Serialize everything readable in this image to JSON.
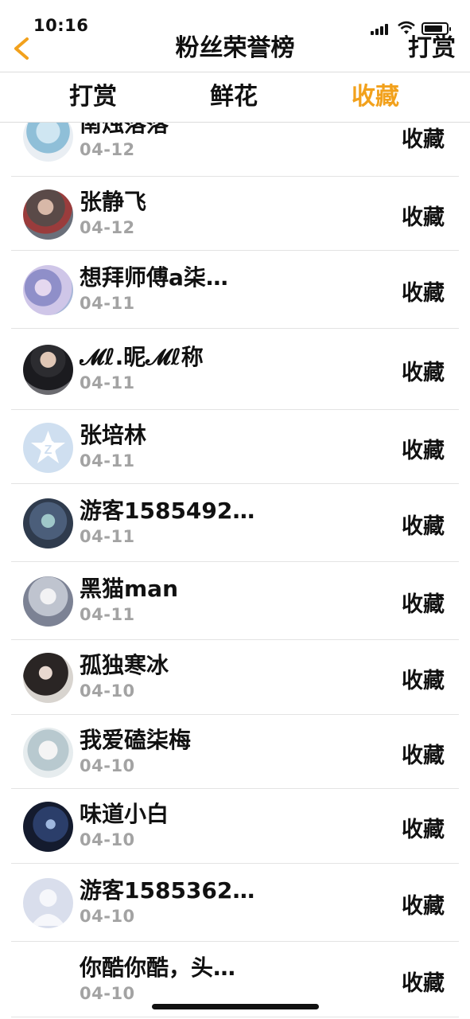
{
  "status_bar": {
    "time": "10:16",
    "battery_level": 0.85
  },
  "nav": {
    "title": "粉丝荣誉榜",
    "right_label": "打赏",
    "back_icon": "chevron-left-icon",
    "accent_color": "#f2a11c"
  },
  "tabs": [
    {
      "label": "打赏",
      "active": false
    },
    {
      "label": "鲜花",
      "active": false
    },
    {
      "label": "收藏",
      "active": true
    }
  ],
  "list": {
    "items": [
      {
        "name": "南烛落落",
        "date": "04-12",
        "action": "收藏",
        "avatar": "anime-girl-blue-hair"
      },
      {
        "name": "张静飞",
        "date": "04-12",
        "action": "收藏",
        "avatar": "anime-boy-dark"
      },
      {
        "name": "想拜师傅a柒…",
        "date": "04-11",
        "action": "收藏",
        "avatar": "anime-couple-pastel"
      },
      {
        "name": "𝓜ℓ.昵𝓜ℓ称",
        "date": "04-11",
        "action": "收藏",
        "avatar": "boy-photo-dark-shirt"
      },
      {
        "name": "张培林",
        "date": "04-11",
        "action": "收藏",
        "avatar": "default-star-icon"
      },
      {
        "name": "游客1585492…",
        "date": "04-11",
        "action": "收藏",
        "avatar": "anime-duo-night"
      },
      {
        "name": "黑猫man",
        "date": "04-11",
        "action": "收藏",
        "avatar": "anime-boy-white-hair"
      },
      {
        "name": "孤独寒冰",
        "date": "04-10",
        "action": "收藏",
        "avatar": "girl-photo-dark"
      },
      {
        "name": "我爱磕柒梅",
        "date": "04-10",
        "action": "收藏",
        "avatar": "anime-sketch-pair"
      },
      {
        "name": "味道小白",
        "date": "04-10",
        "action": "收藏",
        "avatar": "anime-dark-blue"
      },
      {
        "name": "游客1585362…",
        "date": "04-10",
        "action": "收藏",
        "avatar": "default-person-icon"
      },
      {
        "name": "你酷你酷，头…",
        "date": "04-10",
        "action": "收藏",
        "avatar": "none"
      }
    ]
  }
}
